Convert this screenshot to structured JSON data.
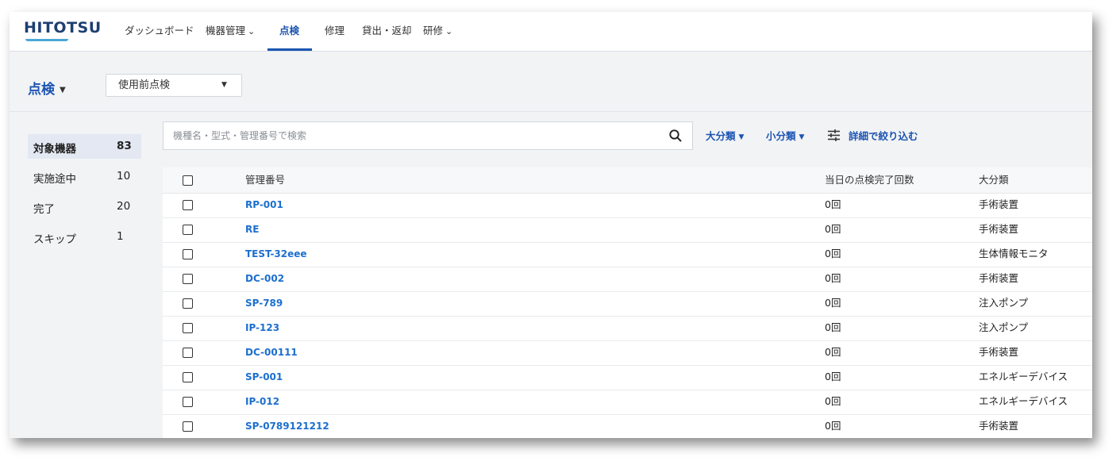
{
  "app": {
    "logo": "HITOTSU"
  },
  "nav": {
    "items": [
      {
        "label": "ダッシュボード",
        "has_dropdown": false,
        "active": false
      },
      {
        "label": "機器管理",
        "has_dropdown": true,
        "active": false
      },
      {
        "label": "点検",
        "has_dropdown": false,
        "active": true
      },
      {
        "label": "修理",
        "has_dropdown": false,
        "active": false
      },
      {
        "label": "貸出・返却",
        "has_dropdown": false,
        "active": false
      },
      {
        "label": "研修",
        "has_dropdown": true,
        "active": false
      }
    ]
  },
  "header": {
    "title": "点検",
    "inspection_type": "使用前点検"
  },
  "sidebar": {
    "items": [
      {
        "label": "対象機器",
        "count": "83",
        "active": true
      },
      {
        "label": "実施途中",
        "count": "10",
        "active": false
      },
      {
        "label": "完了",
        "count": "20",
        "active": false
      },
      {
        "label": "スキップ",
        "count": "1",
        "active": false
      }
    ]
  },
  "toolbar": {
    "search_placeholder": "機種名・型式・管理番号で検索",
    "category_large": "大分類",
    "category_small": "小分類",
    "advanced_filter": "詳細で絞り込む"
  },
  "table": {
    "columns": [
      "管理番号",
      "当日の点検完了回数",
      "大分類"
    ],
    "rows": [
      {
        "id": "RP-001",
        "count": "0回",
        "category": "手術装置"
      },
      {
        "id": "RE",
        "count": "0回",
        "category": "手術装置"
      },
      {
        "id": "TEST-32eee",
        "count": "0回",
        "category": "生体情報モニタ"
      },
      {
        "id": "DC-002",
        "count": "0回",
        "category": "手術装置"
      },
      {
        "id": "SP-789",
        "count": "0回",
        "category": "注入ポンプ"
      },
      {
        "id": "IP-123",
        "count": "0回",
        "category": "注入ポンプ"
      },
      {
        "id": "DC-00111",
        "count": "0回",
        "category": "手術装置"
      },
      {
        "id": "SP-001",
        "count": "0回",
        "category": "エネルギーデバイス"
      },
      {
        "id": "IP-012",
        "count": "0回",
        "category": "エネルギーデバイス"
      },
      {
        "id": "SP-0789121212",
        "count": "0回",
        "category": "手術装置"
      }
    ]
  },
  "colors": {
    "accent": "#1c54b2",
    "link": "#1c6fce",
    "logo": "#1e3f72"
  }
}
